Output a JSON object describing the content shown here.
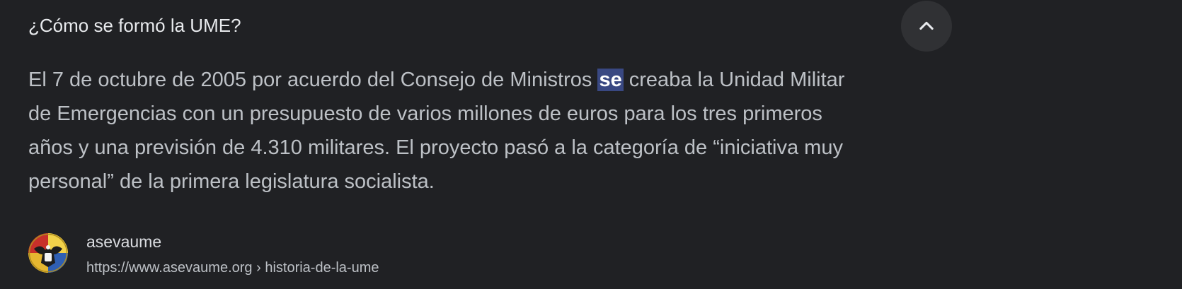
{
  "question": "¿Cómo se formó la UME?",
  "toggle_icon": "chevron-up-icon",
  "answer": {
    "line1_before": "El 7 de octubre de 2005 por acuerdo del Consejo de Ministros ",
    "line1_highlight": "se",
    "line1_after": " creaba la Unidad Militar",
    "line2": "de Emergencias con un presupuesto de varios millones de euros para los tres primeros",
    "line3": "años y una previsión de 4.310 militares. El proyecto pasó a la categoría de “iniciativa muy",
    "line4": "personal” de la primera legislatura socialista."
  },
  "source": {
    "favicon_icon": "asevaume-emblem-icon",
    "name": "asevaume",
    "url": "https://www.asevaume.org › historia-de-la-ume"
  },
  "colors": {
    "background": "#202124",
    "highlight": "#394882",
    "toggle_background": "#303134"
  }
}
